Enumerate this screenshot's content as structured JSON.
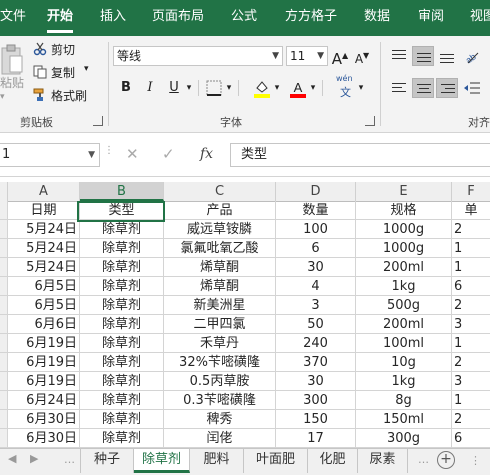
{
  "ribbon_tabs": [
    "文件",
    "开始",
    "插入",
    "页面布局",
    "公式",
    "方方格子",
    "数据",
    "审阅",
    "视图"
  ],
  "clipboard": {
    "paste": "粘贴",
    "cut": "剪切",
    "copy": "复制",
    "format_painter": "格式刷",
    "group_label": "剪贴板"
  },
  "font": {
    "name": "等线",
    "size": "11",
    "grow": "A",
    "shrink": "A",
    "bold": "B",
    "italic": "I",
    "underline": "U",
    "phonetic_top": "wén",
    "phonetic_bottom": "文",
    "group_label": "字体",
    "fill_color": "#ffff00",
    "font_color": "#ff0000"
  },
  "alignment": {
    "group_label": "对齐"
  },
  "formula_bar": {
    "name_box": "1",
    "fx": "fx",
    "content": "类型"
  },
  "columns": [
    "A",
    "B",
    "C",
    "D",
    "E",
    "F"
  ],
  "rows": [
    [
      "日期",
      "类型",
      "产品",
      "数量",
      "规格",
      "单"
    ],
    [
      "5月24日",
      "除草剂",
      "威远草铵膦",
      "100",
      "1000g",
      "2"
    ],
    [
      "5月24日",
      "除草剂",
      "氯氟吡氧乙酸",
      "6",
      "1000g",
      "1"
    ],
    [
      "5月24日",
      "除草剂",
      "烯草酮",
      "30",
      "200ml",
      "1"
    ],
    [
      "6月5日",
      "除草剂",
      "烯草酮",
      "4",
      "1kg",
      "6"
    ],
    [
      "6月5日",
      "除草剂",
      "新美洲星",
      "3",
      "500g",
      "2"
    ],
    [
      "6月6日",
      "除草剂",
      "二甲四氯",
      "50",
      "200ml",
      "3"
    ],
    [
      "6月19日",
      "除草剂",
      "禾草丹",
      "240",
      "100ml",
      "1"
    ],
    [
      "6月19日",
      "除草剂",
      "32%苄嘧磺隆",
      "370",
      "10g",
      "2"
    ],
    [
      "6月19日",
      "除草剂",
      "0.5丙草胺",
      "30",
      "1kg",
      "3"
    ],
    [
      "6月24日",
      "除草剂",
      "0.3苄嘧磺隆",
      "300",
      "8g",
      "1"
    ],
    [
      "6月30日",
      "除草剂",
      "稗秀",
      "150",
      "150ml",
      "2"
    ],
    [
      "6月30日",
      "除草剂",
      "闰佬",
      "17",
      "300g",
      "6"
    ]
  ],
  "sheet_tabs": [
    "种子",
    "除草剂",
    "肥料",
    "叶面肥",
    "化肥",
    "尿素"
  ],
  "active_sheet": "除草剂",
  "accent_color": "#217346"
}
